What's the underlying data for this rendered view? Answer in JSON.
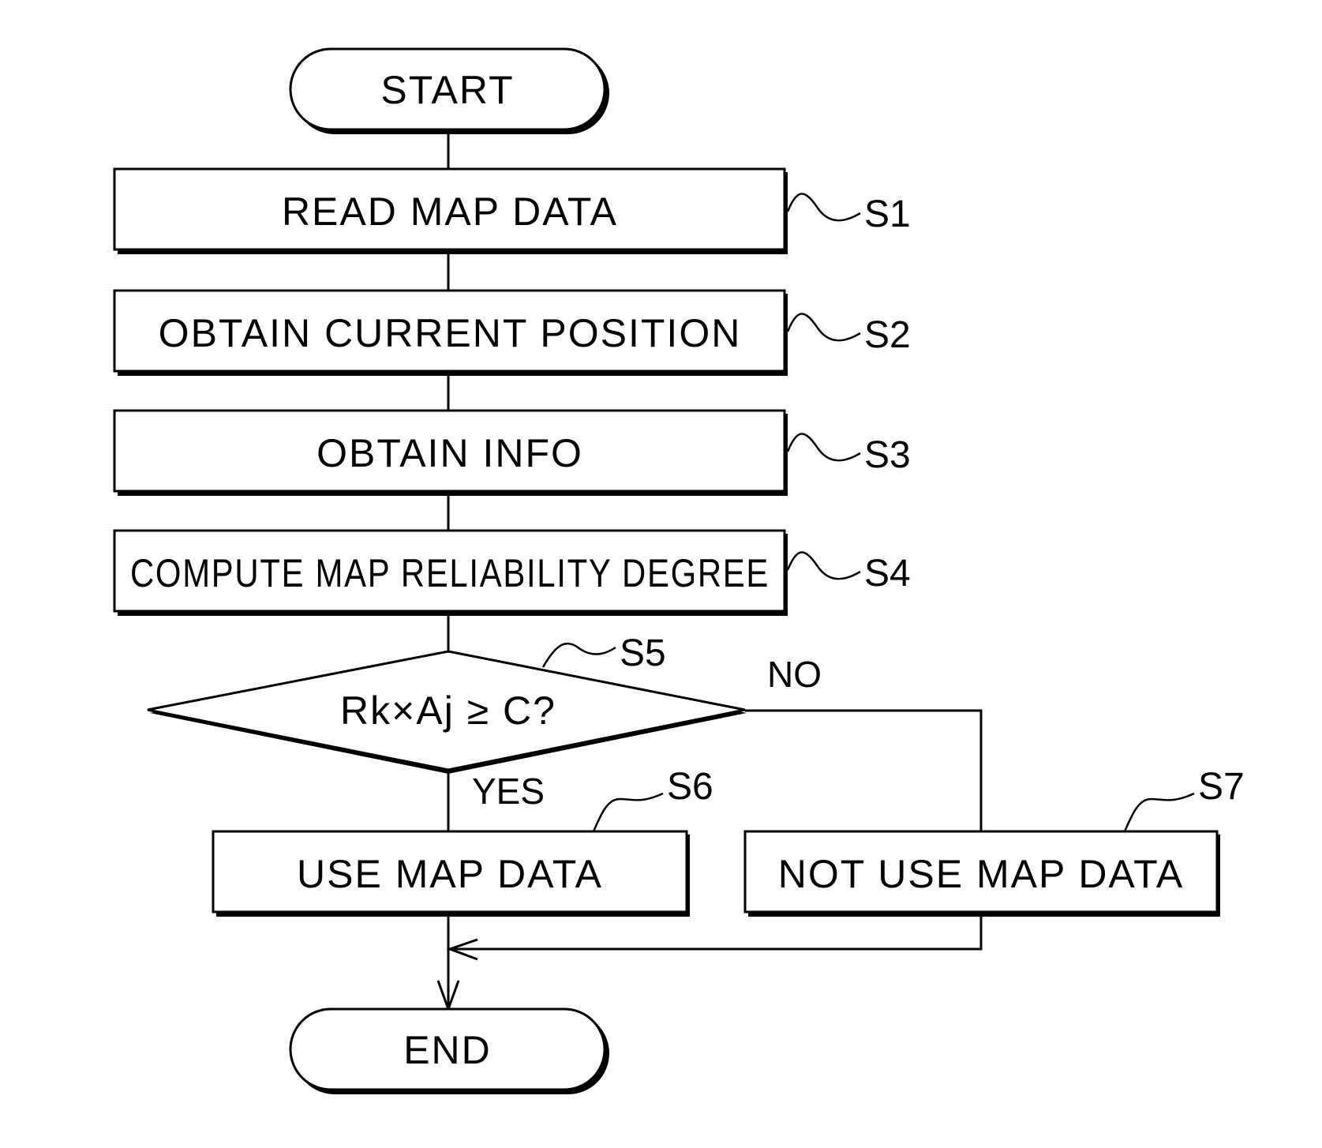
{
  "diagram": {
    "type": "flowchart",
    "terminals": {
      "start": "START",
      "end": "END"
    },
    "steps": [
      {
        "id": "S1",
        "label": "READ MAP DATA"
      },
      {
        "id": "S2",
        "label": "OBTAIN CURRENT POSITION"
      },
      {
        "id": "S3",
        "label": "OBTAIN INFO"
      },
      {
        "id": "S4",
        "label": "COMPUTE MAP RELIABILITY DEGREE"
      }
    ],
    "decision": {
      "id": "S5",
      "label": "Rk×Aj ≥ C?",
      "yes_label": "YES",
      "no_label": "NO"
    },
    "yes_step": {
      "id": "S6",
      "label": "USE MAP DATA"
    },
    "no_step": {
      "id": "S7",
      "label": "NOT USE MAP DATA"
    },
    "edges": [
      [
        "START",
        "S1"
      ],
      [
        "S1",
        "S2"
      ],
      [
        "S2",
        "S3"
      ],
      [
        "S3",
        "S4"
      ],
      [
        "S4",
        "S5"
      ],
      [
        "S5",
        "S6",
        "YES"
      ],
      [
        "S5",
        "S7",
        "NO"
      ],
      [
        "S6",
        "END"
      ],
      [
        "S7",
        "END"
      ]
    ]
  }
}
